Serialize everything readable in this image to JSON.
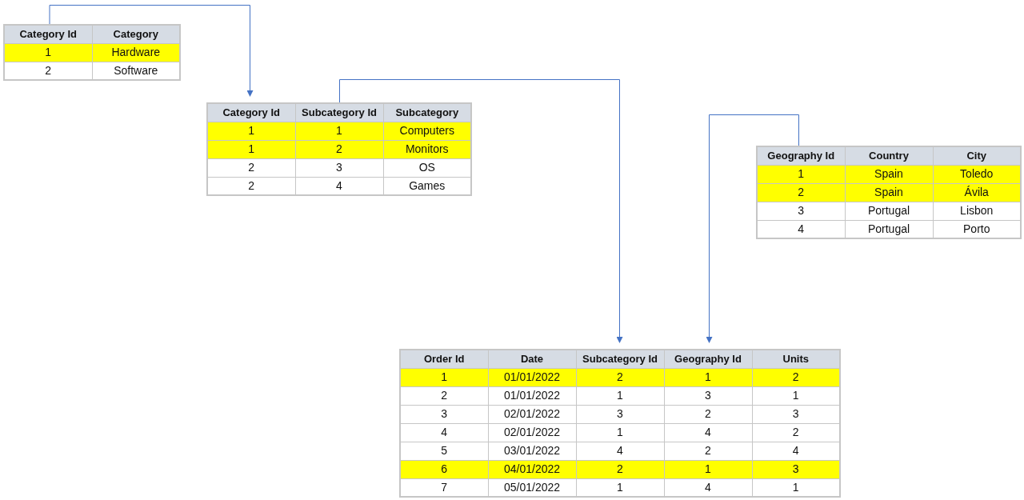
{
  "tables": [
    {
      "columns": [
        "Category Id",
        "Category"
      ],
      "rows": [
        {
          "cells": [
            "1",
            "Hardware"
          ],
          "highlighted": true
        },
        {
          "cells": [
            "2",
            "Software"
          ],
          "highlighted": false
        }
      ]
    },
    {
      "columns": [
        "Category Id",
        "Subcategory Id",
        "Subcategory"
      ],
      "rows": [
        {
          "cells": [
            "1",
            "1",
            "Computers"
          ],
          "highlighted": true
        },
        {
          "cells": [
            "1",
            "2",
            "Monitors"
          ],
          "highlighted": true
        },
        {
          "cells": [
            "2",
            "3",
            "OS"
          ],
          "highlighted": false
        },
        {
          "cells": [
            "2",
            "4",
            "Games"
          ],
          "highlighted": false
        }
      ]
    },
    {
      "columns": [
        "Geography Id",
        "Country",
        "City"
      ],
      "rows": [
        {
          "cells": [
            "1",
            "Spain",
            "Toledo"
          ],
          "highlighted": true
        },
        {
          "cells": [
            "2",
            "Spain",
            "Ávila"
          ],
          "highlighted": true
        },
        {
          "cells": [
            "3",
            "Portugal",
            "Lisbon"
          ],
          "highlighted": false
        },
        {
          "cells": [
            "4",
            "Portugal",
            "Porto"
          ],
          "highlighted": false
        }
      ]
    },
    {
      "columns": [
        "Order Id",
        "Date",
        "Subcategory Id",
        "Geography Id",
        "Units"
      ],
      "rows": [
        {
          "cells": [
            "1",
            "01/01/2022",
            "2",
            "1",
            "2"
          ],
          "highlighted": true
        },
        {
          "cells": [
            "2",
            "01/01/2022",
            "1",
            "3",
            "1"
          ],
          "highlighted": false
        },
        {
          "cells": [
            "3",
            "02/01/2022",
            "3",
            "2",
            "3"
          ],
          "highlighted": false
        },
        {
          "cells": [
            "4",
            "02/01/2022",
            "1",
            "4",
            "2"
          ],
          "highlighted": false
        },
        {
          "cells": [
            "5",
            "03/01/2022",
            "4",
            "2",
            "4"
          ],
          "highlighted": false
        },
        {
          "cells": [
            "6",
            "04/01/2022",
            "2",
            "1",
            "3"
          ],
          "highlighted": true
        },
        {
          "cells": [
            "7",
            "05/01/2022",
            "1",
            "4",
            "1"
          ],
          "highlighted": false
        }
      ]
    }
  ]
}
